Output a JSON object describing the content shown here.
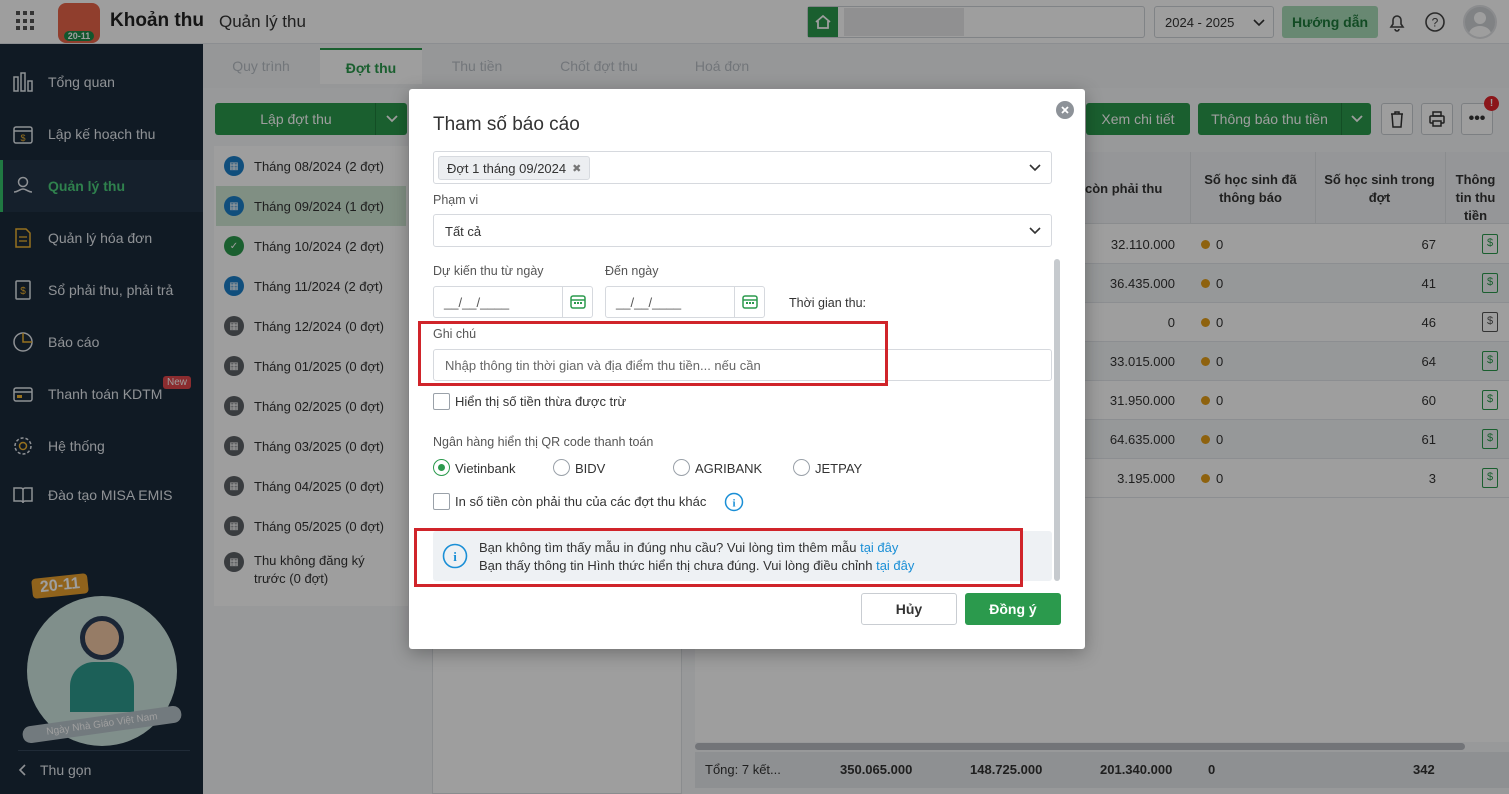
{
  "app": {
    "title": "Khoản thu",
    "subtitle": "Quản lý thu",
    "badge": "20-11",
    "year": "2024 - 2025",
    "guide": "Hướng dẫn"
  },
  "sidebar": {
    "items": [
      {
        "label": "Tổng quan",
        "icon": "bar-chart-icon"
      },
      {
        "label": "Lập kế hoạch thu",
        "icon": "calendar-money-icon"
      },
      {
        "label": "Quản lý thu",
        "icon": "hand-coin-icon"
      },
      {
        "label": "Quản lý hóa đơn",
        "icon": "invoice-icon"
      },
      {
        "label": "Sổ phải thu, phải trả",
        "icon": "ledger-icon"
      },
      {
        "label": "Báo cáo",
        "icon": "pie-chart-icon"
      },
      {
        "label": "Thanh toán KDTM",
        "icon": "card-icon",
        "badge": "New"
      },
      {
        "label": "Hệ thống",
        "icon": "gear-icon"
      },
      {
        "label": "Đào tạo MISA EMIS",
        "icon": "book-icon"
      }
    ],
    "banner": {
      "title": "20-11",
      "caption": "Ngày Nhà Giáo Việt Nam"
    },
    "collapse": "Thu gọn"
  },
  "tabs": [
    "Quy trình",
    "Đợt thu",
    "Thu tiền",
    "Chốt đợt thu",
    "Hoá đơn"
  ],
  "toolbar": {
    "create": "Lập đợt thu",
    "detail": "Xem chi tiết",
    "notify": "Thông báo thu tiền",
    "notif_count": "!"
  },
  "periods": [
    {
      "label": "Tháng 08/2024 (2 đợt)",
      "status": "blue"
    },
    {
      "label": "Tháng 09/2024 (1 đợt)",
      "status": "blue"
    },
    {
      "label": "Tháng 10/2024 (2 đợt)",
      "status": "green"
    },
    {
      "label": "Tháng 11/2024 (2 đợt)",
      "status": "blue"
    },
    {
      "label": "Tháng 12/2024 (0 đợt)",
      "status": "gray"
    },
    {
      "label": "Tháng 01/2025 (0 đợt)",
      "status": "gray"
    },
    {
      "label": "Tháng 02/2025 (0 đợt)",
      "status": "gray"
    },
    {
      "label": "Tháng 03/2025 (0 đợt)",
      "status": "gray"
    },
    {
      "label": "Tháng 04/2025 (0 đợt)",
      "status": "gray"
    },
    {
      "label": "Tháng 05/2025 (0 đợt)",
      "status": "gray"
    },
    {
      "label": "Thu không đăng ký trước (0 đợt)",
      "status": "gray"
    }
  ],
  "table": {
    "headers": [
      "còn phải thu",
      "Số học sinh đã thông báo",
      "Số học sinh trong đợt",
      "Thông tin thu tiền"
    ],
    "rows": [
      {
        "remain": "32.110.000",
        "notified": "0",
        "students": "67"
      },
      {
        "remain": "36.435.000",
        "notified": "0",
        "students": "41"
      },
      {
        "remain": "0",
        "notified": "0",
        "students": "46"
      },
      {
        "remain": "33.015.000",
        "notified": "0",
        "students": "64"
      },
      {
        "remain": "31.950.000",
        "notified": "0",
        "students": "60"
      },
      {
        "remain": "64.635.000",
        "notified": "0",
        "students": "61"
      },
      {
        "remain": "3.195.000",
        "notified": "0",
        "students": "3"
      }
    ],
    "footer": {
      "label": "Tổng: 7 kết...",
      "v1": "350.065.000",
      "v2": "148.725.000",
      "v3": "201.340.000",
      "v4": "0",
      "v5": "342"
    }
  },
  "modal": {
    "title": "Tham số báo cáo",
    "selected_tag": "Đợt 1 tháng 09/2024",
    "scope_label": "Phạm vi",
    "scope_value": "Tất cả",
    "from_label": "Dự kiến thu từ ngày",
    "to_label": "Đến ngày",
    "date_placeholder": "__/__/____",
    "time_label": "Thời gian thu:",
    "note_label": "Ghi chú",
    "note_placeholder": "Nhập thông tin thời gian và địa điểm thu tiền... nếu cần",
    "show_excess": "Hiển thị số tiền thừa được trừ",
    "bank_label": "Ngân hàng hiển thị QR code thanh toán",
    "banks": [
      "Vietinbank",
      "BIDV",
      "AGRIBANK",
      "JETPAY"
    ],
    "print_other": "In số tiền còn phải thu của các đợt thu khác",
    "info1": "Bạn không tìm thấy mẫu in đúng nhu cầu? Vui lòng tìm thêm mẫu ",
    "info1_link": "tại đây",
    "info2": "Bạn thấy thông tin Hình thức hiển thị chưa đúng. Vui lòng điều chỉnh ",
    "info2_link": "tại đây",
    "cancel": "Hủy",
    "ok": "Đồng ý"
  }
}
